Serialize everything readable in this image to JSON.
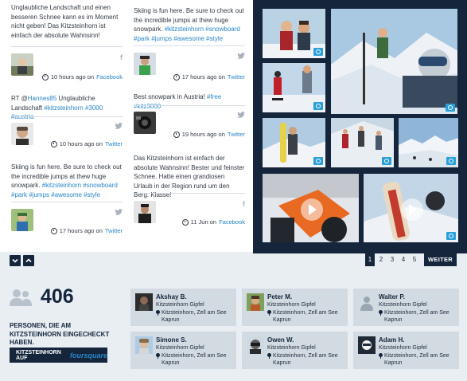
{
  "feed": {
    "posts": [
      {
        "text": "Unglaubliche Landschaft und einen besseren Schnee kann es im Moment nicht geben! Das Kitzsteinhorn ist einfach der absolute Wahnsinn!",
        "time": "10 hours ago on",
        "network": "Facebook",
        "source_icon": "facebook-icon",
        "source_glyph": "f"
      },
      {
        "text_prefix": "RT @",
        "mention": "Hannes85",
        "text_middle": " Unglaubliche Landschaft ",
        "tags": "#kitzsteinhorn #3000 #austria",
        "time": "10 hours ago on",
        "network": "Twitter",
        "source_icon": "twitter-icon",
        "source_glyph": "t"
      },
      {
        "text": "Skiing is fun here. Be sure to check out the incredible jumps at thew huge snowpark. ",
        "tags": "#kitzsteinhorn #snowboard #park #jumps #awesome #style",
        "time": "17 hours ago on",
        "network": "Twitter",
        "source_icon": "twitter-icon",
        "source_glyph": "t"
      },
      {
        "text": "Skiing is fun here. Be sure to check out the incredible jumps at thew huge snowpark. ",
        "tags": "#kitzsteinhorn #snowboard #park #jumps #awesome #style",
        "time": "17 hours ago on",
        "network": "Twitter",
        "source_icon": "twitter-icon",
        "source_glyph": "t"
      },
      {
        "text": "Best snowpark in Austria! ",
        "tags": "#free #kitz3000",
        "time": "19 hours ago on",
        "network": "Twitter",
        "source_icon": "twitter-icon",
        "source_glyph": "t"
      },
      {
        "text": "Das Kitzsteinhorn ist einfach der absolute Wahnsinn! Bester und feinster Schnee. Hatte einen grandiosen Urlaub in der Region rund um den Berg. Klasse!",
        "time": "11 Jun on",
        "network": "Facebook",
        "source_icon": "facebook-icon",
        "source_glyph": "f"
      }
    ]
  },
  "pager": {
    "pages": [
      "1",
      "2",
      "3",
      "4",
      "5"
    ],
    "active": "1",
    "next_label": "WEITER"
  },
  "checkins": {
    "count": "406",
    "caption": "PERSONEN, DIE AM KITZSTEINHORN EINGECHECKT HABEN.",
    "button_label": "KITZSTEINHORN AUF",
    "button_brand": "foursquare",
    "people": [
      {
        "name": "Akshay B.",
        "venue": "Kitzsteinhorn Gipfel",
        "address": "Kitzsteinhorn, Zell am See Kaprun"
      },
      {
        "name": "Peter M.",
        "venue": "Kitzsteinhorn Gipfel",
        "address": "Kitzsteinhorn, Zell am See Kaprun"
      },
      {
        "name": "Walter P.",
        "venue": "Kitzsteinhorn Gipfel",
        "address": "Kitzsteinhorn, Zell am See Kaprun"
      },
      {
        "name": "Simone S.",
        "venue": "Kitzsteinhorn Gipfel",
        "address": "Kitzsteinhorn, Zell am See Kaprun"
      },
      {
        "name": "Owen W.",
        "venue": "Kitzsteinhorn Gipfel",
        "address": "Kitzsteinhorn, Zell am See Kaprun"
      },
      {
        "name": "Adam H.",
        "venue": "Kitzsteinhorn Gipfel",
        "address": "Kitzsteinhorn, Zell am See Kaprun"
      }
    ]
  },
  "colors": {
    "navy": "#14253c",
    "link_blue": "#2b86c7",
    "camera_badge": "#2a9fd8",
    "card_bg": "#d3dbe2",
    "page_bg": "#e9eef3"
  },
  "icons": {
    "scroll_down": "chevron-down-icon",
    "scroll_up": "chevron-up-icon",
    "people": "people-icon",
    "location": "pin-icon",
    "time": "clock-icon",
    "photo_badge": "camera-icon",
    "video": "play-icon"
  }
}
